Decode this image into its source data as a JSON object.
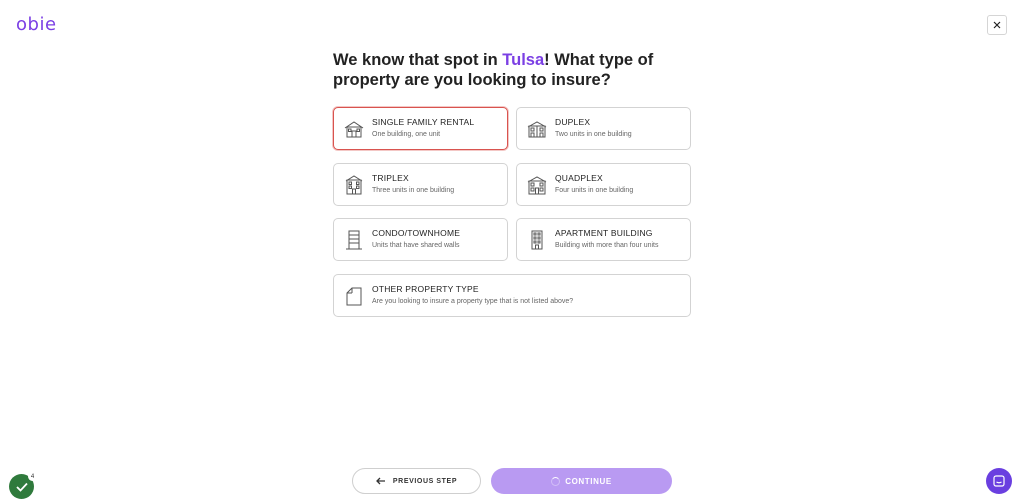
{
  "brand": {
    "logo": "obie",
    "accent_color": "#7b3fe4"
  },
  "header": {
    "close_icon": "close-icon"
  },
  "question": {
    "prefix": "We know that spot in ",
    "city": "Tulsa",
    "suffix": "! What type of property are you looking to insure?"
  },
  "options": [
    {
      "id": "single-family-rental",
      "title": "SINGLE FAMILY RENTAL",
      "subtitle": "One building, one unit",
      "icon": "house-icon",
      "selected": true
    },
    {
      "id": "duplex",
      "title": "DUPLEX",
      "subtitle": "Two units in one building",
      "icon": "duplex-icon",
      "selected": false
    },
    {
      "id": "triplex",
      "title": "TRIPLEX",
      "subtitle": "Three units in one building",
      "icon": "triplex-icon",
      "selected": false
    },
    {
      "id": "quadplex",
      "title": "QUADPLEX",
      "subtitle": "Four units in one building",
      "icon": "quadplex-icon",
      "selected": false
    },
    {
      "id": "condo-townhome",
      "title": "CONDO/TOWNHOME",
      "subtitle": "Units that have shared walls",
      "icon": "condo-icon",
      "selected": false
    },
    {
      "id": "apartment-building",
      "title": "APARTMENT BUILDING",
      "subtitle": "Building with more than four units",
      "icon": "apartment-icon",
      "selected": false
    },
    {
      "id": "other-property-type",
      "title": "OTHER PROPERTY TYPE",
      "subtitle": "Are you looking to insure a property type that is not listed above?",
      "icon": "other-property-icon",
      "selected": false
    }
  ],
  "footer": {
    "previous_label": "PREVIOUS STEP",
    "continue_label": "CONTINUE",
    "continue_color": "#b99af2"
  },
  "widgets": {
    "badge_count": "4",
    "badge_color": "#2f7a3c",
    "chat_color": "#6a3fe0"
  }
}
